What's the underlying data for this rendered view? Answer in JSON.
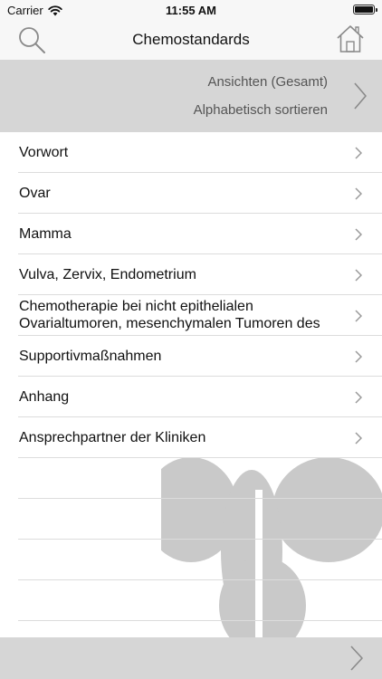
{
  "status_bar": {
    "carrier": "Carrier",
    "time": "11:55 AM"
  },
  "nav": {
    "title": "Chemostandards",
    "left_icon": "search-icon",
    "right_icon": "home-icon"
  },
  "sort_header": {
    "view": "Ansichten (Gesamt)",
    "order": "Alphabetisch sortieren"
  },
  "list": {
    "items": [
      {
        "label": "Vorwort"
      },
      {
        "label": "Ovar"
      },
      {
        "label": "Mamma"
      },
      {
        "label": "Vulva, Zervix, Endometrium"
      },
      {
        "label": "Chemotherapie bei nicht epithelialen Ovarialtumoren, mesenchymalen Tumoren des"
      },
      {
        "label": "Supportivmaßnahmen"
      },
      {
        "label": "Anhang"
      },
      {
        "label": "Ansprechpartner der Kliniken"
      }
    ]
  },
  "colors": {
    "header_gray": "#d6d6d6",
    "separator": "#dcdcdc",
    "watermark": "#c4c4c4",
    "chevron": "#9a9a9a"
  }
}
